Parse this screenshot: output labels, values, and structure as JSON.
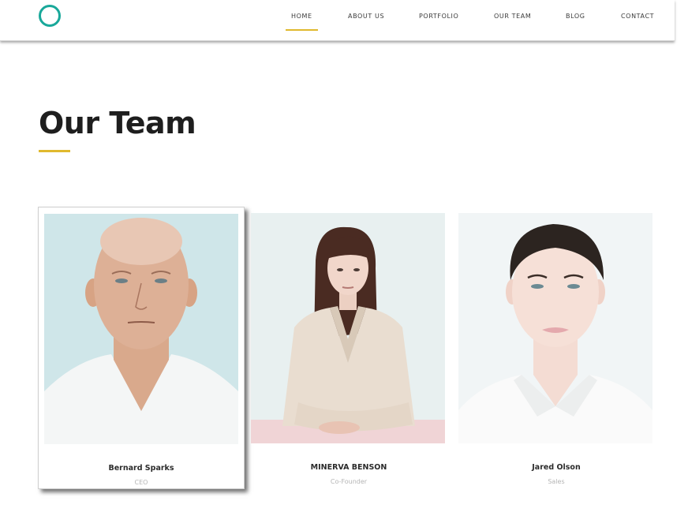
{
  "header": {
    "nav": [
      {
        "label": "HOME",
        "active": true
      },
      {
        "label": "ABOUT US",
        "active": false
      },
      {
        "label": "PORTFOLIO",
        "active": false
      },
      {
        "label": "OUR TEAM",
        "active": false
      },
      {
        "label": "BLOG",
        "active": false
      },
      {
        "label": "CONTACT",
        "active": false
      }
    ]
  },
  "main": {
    "title": "Our Team",
    "team": [
      {
        "name": "Bernard Sparks",
        "role": "CEO"
      },
      {
        "name": "MINERVA BENSON",
        "role": "Co-Founder"
      },
      {
        "name": "Jared Olson",
        "role": "Sales"
      }
    ]
  },
  "colors": {
    "accent": "#e0b92e",
    "logo": "#19a89a"
  }
}
